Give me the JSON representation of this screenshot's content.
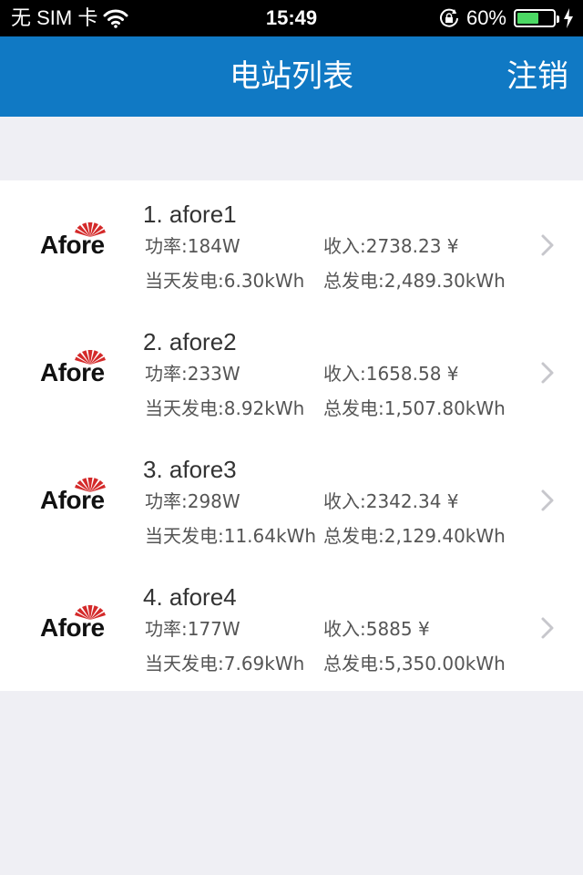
{
  "status_bar": {
    "carrier": "无 SIM 卡",
    "time": "15:49",
    "battery_percent": "60%",
    "battery_level": 0.6,
    "icons": [
      "wifi-icon",
      "rotation-lock-icon",
      "battery-icon",
      "charging-bolt-icon"
    ]
  },
  "nav": {
    "title": "电站列表",
    "logout_label": "注销",
    "color": "#1079c4"
  },
  "stations": [
    {
      "name": "1. afore1",
      "logo_text": "Afore",
      "power": "功率:184W",
      "income": "收入:2738.23 ¥",
      "today": "当天发电:6.30kWh",
      "total": "总发电:2,489.30kWh"
    },
    {
      "name": "2. afore2",
      "logo_text": "Afore",
      "power": "功率:233W",
      "income": "收入:1658.58 ¥",
      "today": "当天发电:8.92kWh",
      "total": "总发电:1,507.80kWh"
    },
    {
      "name": "3. afore3",
      "logo_text": "Afore",
      "power": "功率:298W",
      "income": "收入:2342.34 ¥",
      "today": "当天发电:11.64kWh",
      "total": "总发电:2,129.40kWh"
    },
    {
      "name": "4. afore4",
      "logo_text": "Afore",
      "power": "功率:177W",
      "income": "收入:5885 ¥",
      "today": "当天发电:7.69kWh",
      "total": "总发电:5,350.00kWh"
    }
  ],
  "colors": {
    "background": "#efeff4",
    "logo_accent": "#d42a2a",
    "battery_fill": "#4cd964"
  }
}
